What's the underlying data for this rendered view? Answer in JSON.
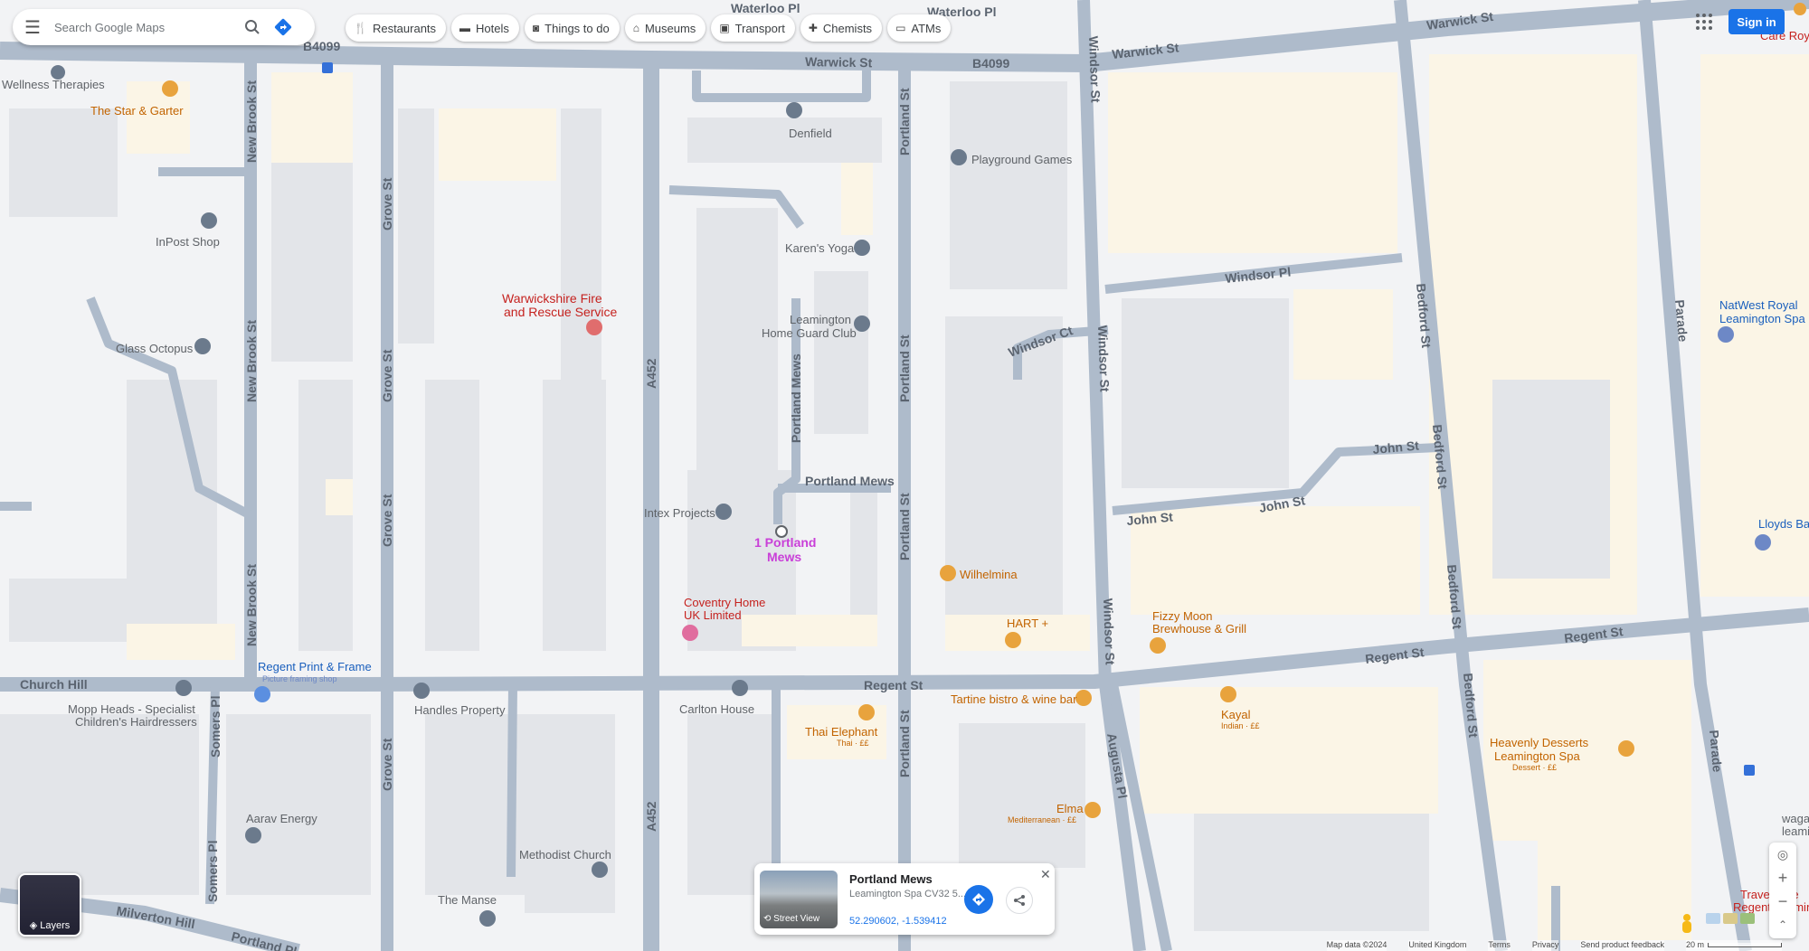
{
  "search": {
    "placeholder": "Search Google Maps"
  },
  "chips": [
    {
      "label": "Restaurants",
      "icon": "fork-knife-icon"
    },
    {
      "label": "Hotels",
      "icon": "bed-icon"
    },
    {
      "label": "Things to do",
      "icon": "camera-icon"
    },
    {
      "label": "Museums",
      "icon": "museum-icon"
    },
    {
      "label": "Transport",
      "icon": "train-icon"
    },
    {
      "label": "Chemists",
      "icon": "pharmacy-icon"
    },
    {
      "label": "ATMs",
      "icon": "atm-icon"
    }
  ],
  "header": {
    "signin_label": "Sign in"
  },
  "streets": {
    "warwick_st_1": "Warwick St",
    "warwick_st_2": "Warwick St",
    "warwick_st_3": "Warwick St",
    "b4099_1": "B4099",
    "b4099_2": "B4099",
    "waterloo_pl_1": "Waterloo Pl",
    "waterloo_pl_2": "Waterloo Pl",
    "new_brook_st_1": "New Brook St",
    "new_brook_st_2": "New Brook St",
    "new_brook_st_3": "New Brook St",
    "grove_st_1": "Grove St",
    "grove_st_2": "Grove St",
    "grove_st_3": "Grove St",
    "grove_st_4": "Grove St",
    "a452_1": "A452",
    "a452_2": "A452",
    "portland_st_1": "Portland St",
    "portland_st_2": "Portland St",
    "portland_st_3": "Portland St",
    "portland_st_4": "Portland St",
    "portland_mews_1": "Portland Mews",
    "portland_mews_2": "Portland Mews",
    "windsor_st_1": "Windsor St",
    "windsor_st_2": "Windsor St",
    "windsor_st_3": "Windsor St",
    "windsor_pl": "Windsor Pl",
    "windsor_ct": "Windsor Ct",
    "john_st_1": "John St",
    "john_st_2": "John St",
    "john_st_3": "John St",
    "bedford_st_1": "Bedford St",
    "bedford_st_2": "Bedford St",
    "bedford_st_3": "Bedford St",
    "bedford_st_4": "Bedford St",
    "parade_1": "Parade",
    "parade_2": "Parade",
    "regent_st_1": "Regent St",
    "regent_st_2": "Regent St",
    "regent_st_3": "Regent St",
    "church_hill": "Church Hill",
    "somers_pl_1": "Somers Pl",
    "somers_pl_2": "Somers Pl",
    "augusta_pl": "Augusta Pl",
    "milverton_hill": "Milverton Hill",
    "portland_pl": "Portland Pl"
  },
  "pois": {
    "wellness": "Wellness\nTherapies",
    "star_garter": "The Star & Garter",
    "denfield": "Denfield",
    "playground_games": "Playground Games",
    "inpost_shop": "InPost Shop",
    "karens_yoga": "Karen's Yoga",
    "warwickshire_fire": "Warwickshire Fire\nand Rescue Service",
    "leamington_home_guard": "Leamington\nHome Guard Club",
    "glass_octopus": "Glass Octopus",
    "natwest": "NatWest Royal\nLeamington Spa",
    "intex_projects": "Intex Projects",
    "portland_mews_pin": "1 Portland\nMews",
    "lloyds": "Lloyds Bar",
    "wilhelmina": "Wilhelmina",
    "coventry_home": "Coventry Home\nUK Limited",
    "hart_plus": "HART +",
    "fizzy_moon": "Fizzy Moon\nBrewhouse & Grill",
    "regent_print": "Regent Print & Frame",
    "regent_print_sub": "Picture framing shop",
    "mopp_heads": "Mopp Heads - Specialist\nChildren's Hairdressers",
    "handles_property": "Handles Property",
    "carlton_house": "Carlton House",
    "tartine": "Tartine bistro & wine bar",
    "kayal": "Kayal",
    "kayal_sub": "Indian · ££",
    "thai_elephant": "Thai Elephant",
    "thai_elephant_sub": "Thai · ££",
    "heavenly_desserts": "Heavenly Desserts\nLeamington Spa",
    "heavenly_sub": "Dessert · ££",
    "aarav_energy": "Aarav Energy",
    "methodist_church": "Methodist Church",
    "elma": "Elma",
    "elma_sub": "Mediterranean · ££",
    "the_manse": "The Manse",
    "care_royal": "Care Royal",
    "travelodge": "Travelodge\nRegent Leamington",
    "waga": "waga\nleami"
  },
  "layers": {
    "label": "Layers"
  },
  "card": {
    "title": "Portland Mews",
    "subtitle": "Leamington Spa CV32 5...",
    "coords": "52.290602, -1.539412",
    "street_view_label": "Street View"
  },
  "footer": {
    "map_data": "Map data ©2024",
    "country": "United Kingdom",
    "terms": "Terms",
    "privacy": "Privacy",
    "feedback": "Send product feedback",
    "scale": "20 m"
  },
  "colors": {
    "accent": "#1a73e8",
    "pin_magenta": "#c93fd8",
    "road": "#aebbcb",
    "red_label": "#c5221f",
    "orange": "#e8a33d"
  }
}
